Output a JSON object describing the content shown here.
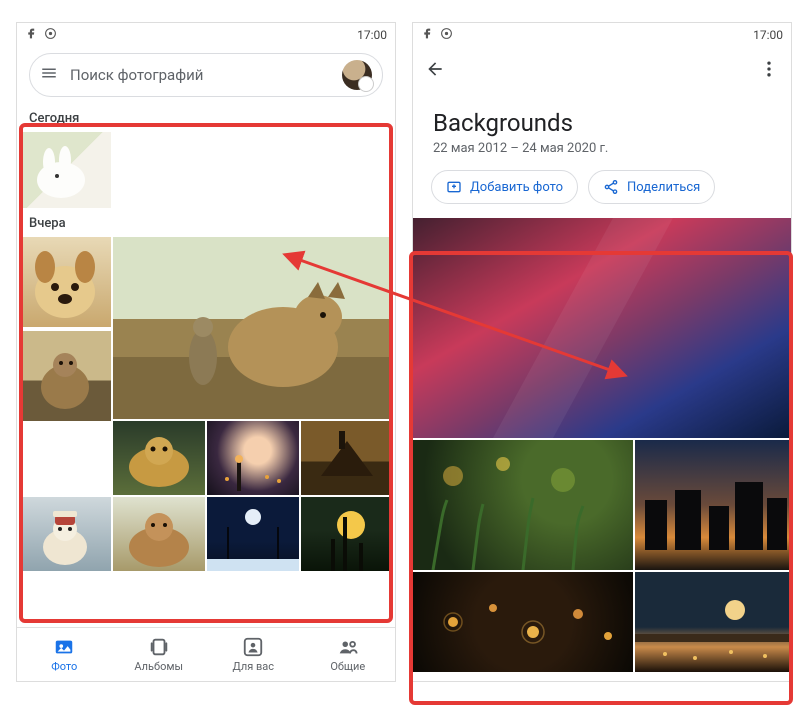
{
  "status": {
    "time": "17:00"
  },
  "left": {
    "search_placeholder": "Поиск фотографий",
    "section_today": "Сегодня",
    "section_yesterday": "Вчера",
    "nav": {
      "photos": "Фото",
      "albums": "Альбомы",
      "for_you": "Для вас",
      "shared": "Общие"
    }
  },
  "right": {
    "title": "Backgrounds",
    "dates": "22 мая 2012 – 24 мая 2020 г.",
    "add_photo": "Добавить фото",
    "share": "Поделиться"
  }
}
